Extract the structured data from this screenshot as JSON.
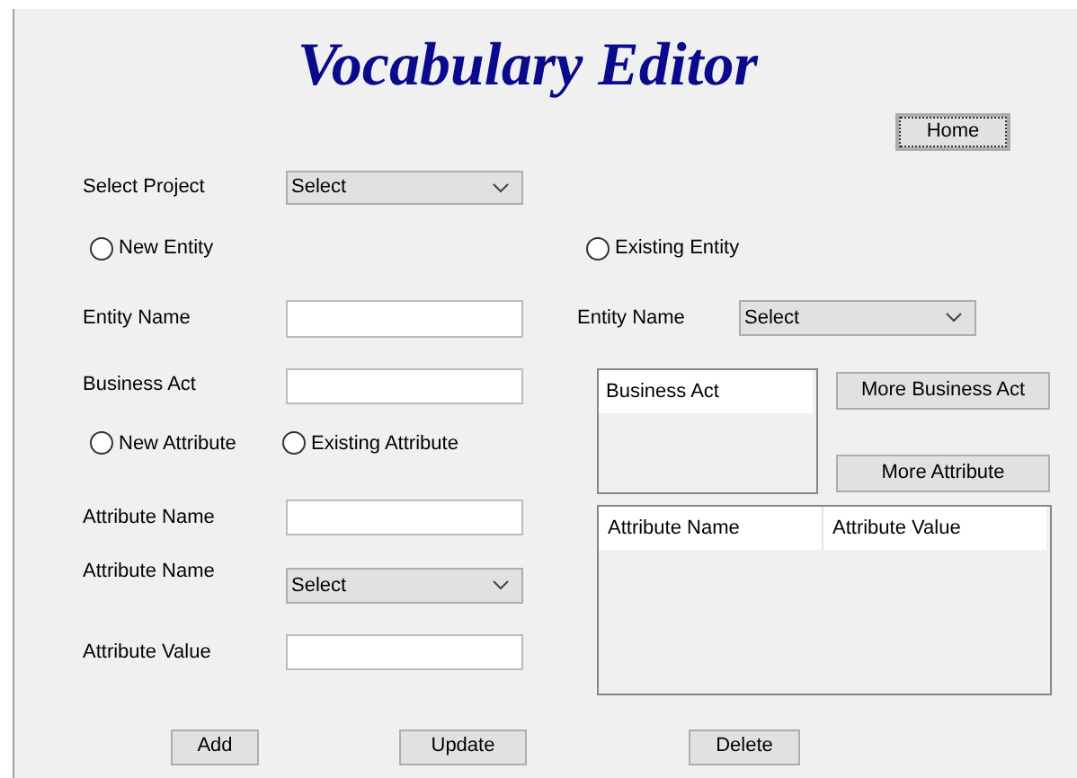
{
  "title": "Vocabulary Editor",
  "home_button": "Home",
  "project": {
    "label": "Select Project",
    "value": "Select"
  },
  "entity_mode": [
    {
      "label": "New Entity",
      "selected": false
    },
    {
      "label": "Existing Entity",
      "selected": false
    }
  ],
  "entity_name_label": "Entity Name",
  "existing_entity": {
    "label": "Entity Name",
    "value": "Select"
  },
  "business_act_label": "Business Act",
  "attribute_mode": [
    {
      "label": "New Attribute",
      "selected": false
    },
    {
      "label": "Existing Attribute",
      "selected": false
    }
  ],
  "attribute_name_label": "Attribute Name",
  "attribute_select": {
    "label": "Attribute Name",
    "value": "Select"
  },
  "attribute_value_label": "Attribute Value",
  "business_act_list": {
    "header": "Business Act"
  },
  "more_buttons": [
    "More Business Act",
    "More Attribute"
  ],
  "attribute_table": {
    "columns": [
      "Attribute Name",
      "Attribute Value"
    ]
  },
  "buttons": [
    "Add",
    "Update",
    "Delete"
  ]
}
